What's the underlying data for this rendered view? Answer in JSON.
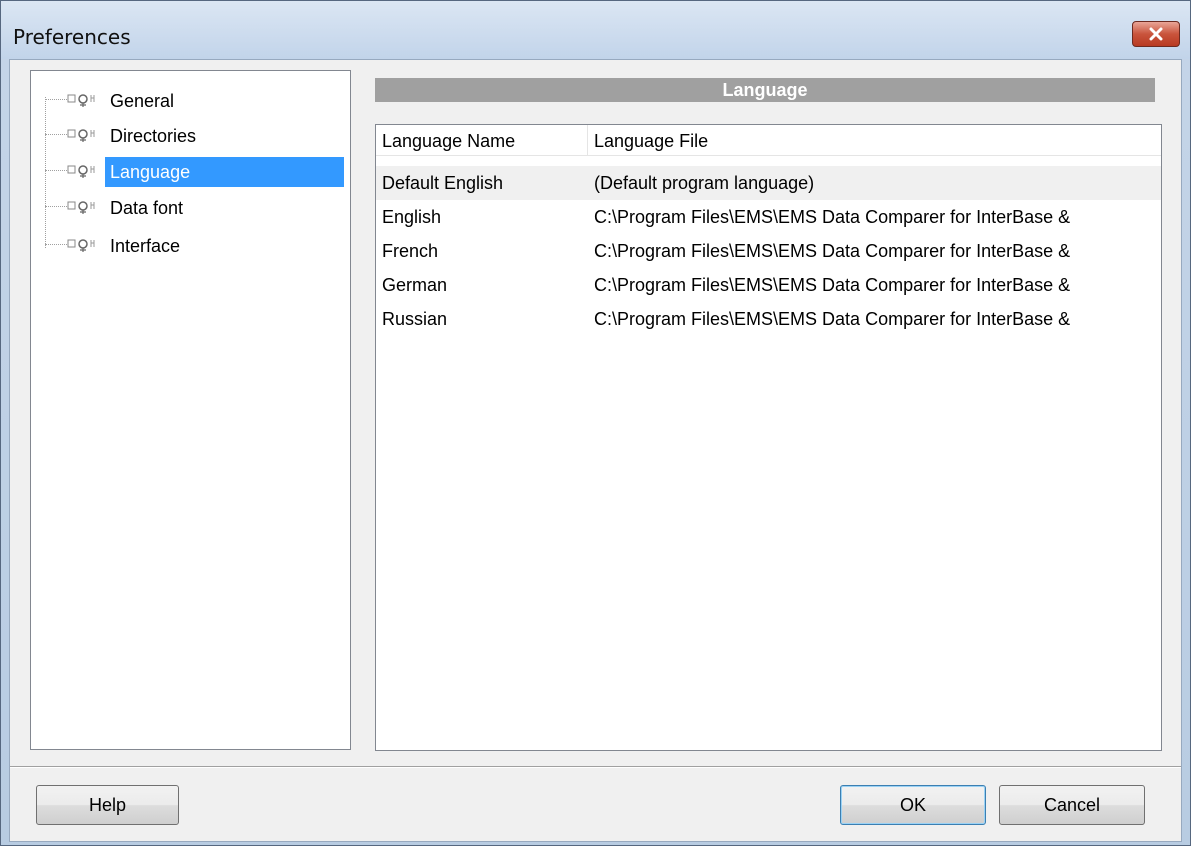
{
  "window": {
    "title": "Preferences"
  },
  "tree": {
    "items": [
      {
        "label": "General"
      },
      {
        "label": "Directories"
      },
      {
        "label": "Language",
        "selected": true
      },
      {
        "label": "Data font"
      },
      {
        "label": "Interface"
      }
    ]
  },
  "panel": {
    "title": "Language"
  },
  "languages": {
    "columns": [
      "Language Name",
      "Language File"
    ],
    "rows": [
      {
        "name": "Default English",
        "file": "(Default program language)",
        "selected": true
      },
      {
        "name": "English",
        "file": "C:\\Program Files\\EMS\\EMS Data Comparer for InterBase &"
      },
      {
        "name": "French",
        "file": "C:\\Program Files\\EMS\\EMS Data Comparer for InterBase &"
      },
      {
        "name": "German",
        "file": "C:\\Program Files\\EMS\\EMS Data Comparer for InterBase &"
      },
      {
        "name": "Russian",
        "file": "C:\\Program Files\\EMS\\EMS Data Comparer for InterBase &"
      }
    ]
  },
  "buttons": {
    "help": "Help",
    "ok": "OK",
    "cancel": "Cancel"
  },
  "colors": {
    "selection": "#3399ff",
    "header_bar": "#a0a0a0",
    "close_button": "#c9543c"
  },
  "icons": {
    "tree_item": "node-icon",
    "close": "close-icon"
  }
}
